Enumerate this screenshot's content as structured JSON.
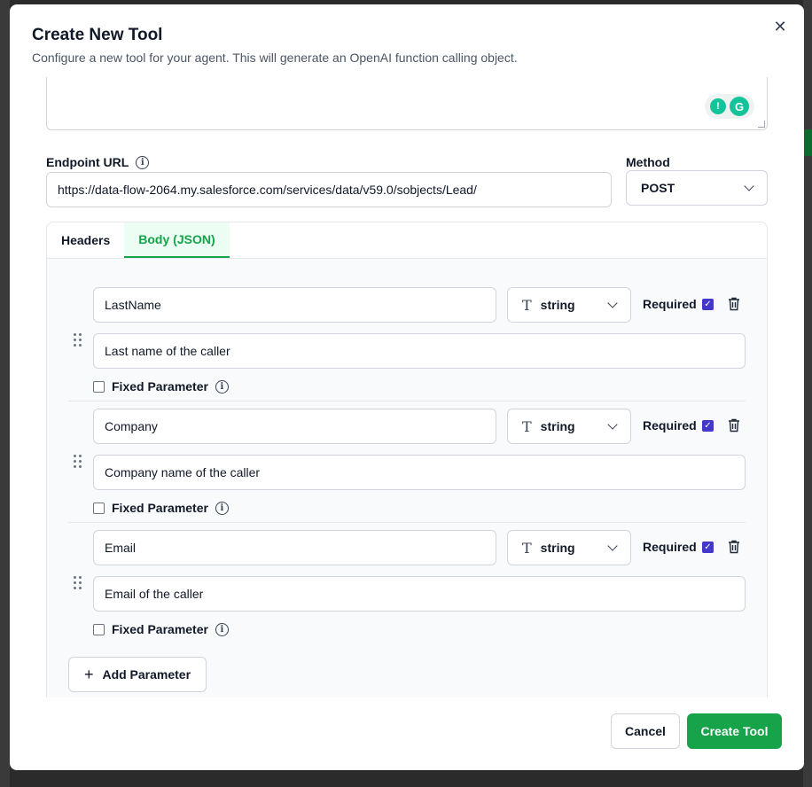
{
  "modal": {
    "title": "Create New Tool",
    "subtitle": "Configure a new tool for your agent. This will generate an OpenAI function calling object.",
    "close_icon": "close-icon"
  },
  "endpoint": {
    "label": "Endpoint URL",
    "url": "https://data-flow-2064.my.salesforce.com/services/data/v59.0/sobjects/Lead/"
  },
  "method": {
    "label": "Method",
    "value": "POST"
  },
  "tabs": [
    {
      "label": "Headers",
      "active": false
    },
    {
      "label": "Body (JSON)",
      "active": true
    }
  ],
  "parameters": [
    {
      "name": "LastName",
      "type": "string",
      "required_label": "Required",
      "required": true,
      "description": "Last name of the caller",
      "fixed_label": "Fixed Parameter",
      "fixed": false
    },
    {
      "name": "Company",
      "type": "string",
      "required_label": "Required",
      "required": true,
      "description": "Company name of the caller",
      "fixed_label": "Fixed Parameter",
      "fixed": false
    },
    {
      "name": "Email",
      "type": "string",
      "required_label": "Required",
      "required": true,
      "description": "Email of the caller",
      "fixed_label": "Fixed Parameter",
      "fixed": false
    }
  ],
  "add_parameter_label": "Add Parameter",
  "footer": {
    "cancel_label": "Cancel",
    "create_label": "Create Tool"
  },
  "colors": {
    "accent": "#16a34a",
    "checkbox": "#4338ca"
  }
}
